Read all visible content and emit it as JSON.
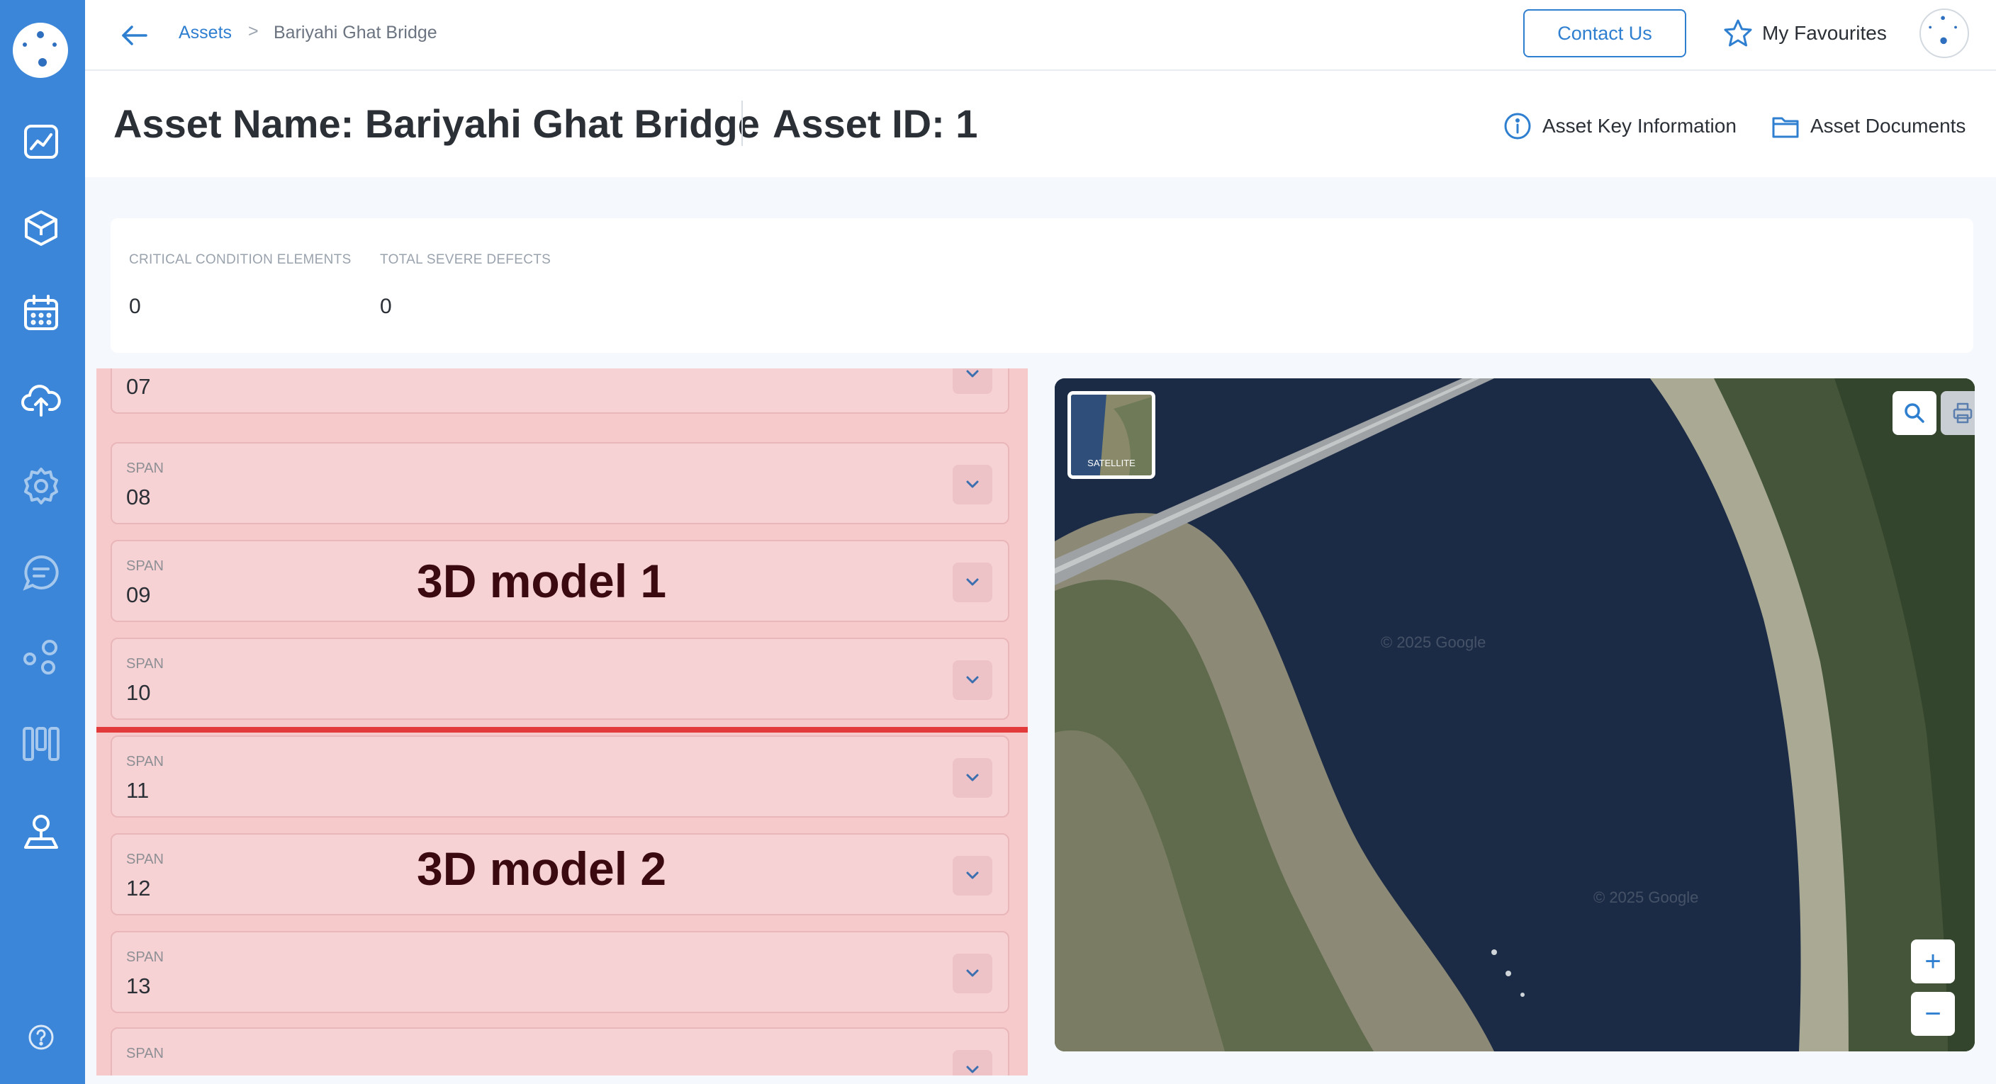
{
  "breadcrumb": {
    "root": "Assets",
    "separator": ">",
    "current": "Bariyahi Ghat Bridge"
  },
  "topbar": {
    "contact_label": "Contact Us",
    "favourites_label": "My Favourites"
  },
  "header": {
    "asset_name": "Asset Name: Bariyahi Ghat Bridge",
    "asset_id": "Asset ID: 1",
    "key_info_label": "Asset Key Information",
    "documents_label": "Asset Documents"
  },
  "stats": {
    "critical_label": "CRITICAL CONDITION ELEMENTS",
    "critical_value": "0",
    "defects_label": "TOTAL SEVERE DEFECTS",
    "defects_value": "0"
  },
  "spans": {
    "items": [
      {
        "label": "",
        "number": "07"
      },
      {
        "label": "SPAN",
        "number": "08"
      },
      {
        "label": "SPAN",
        "number": "09"
      },
      {
        "label": "SPAN",
        "number": "10"
      },
      {
        "label": "SPAN",
        "number": "11"
      },
      {
        "label": "SPAN",
        "number": "12"
      },
      {
        "label": "SPAN",
        "number": "13"
      },
      {
        "label": "SPAN",
        "number": ""
      }
    ]
  },
  "overlays": {
    "model_1": "3D model 1",
    "model_2": "3D model 2"
  },
  "map": {
    "layer_label": "SATELLITE",
    "watermark": "© 2025 Google",
    "zoom_in": "+",
    "zoom_out": "−"
  },
  "colors": {
    "sidebar": "#3b86d8",
    "accent": "#2f7fd1",
    "overlay": "#f6c9cb",
    "divider_line": "#e23a3a"
  },
  "icons": {
    "sidebar": [
      "dashboard-chart-icon",
      "cube-icon",
      "calendar-icon",
      "cloud-upload-icon",
      "settings-icon",
      "chat-icon",
      "network-icon",
      "columns-icon",
      "user-pin-icon",
      "help-icon"
    ]
  }
}
